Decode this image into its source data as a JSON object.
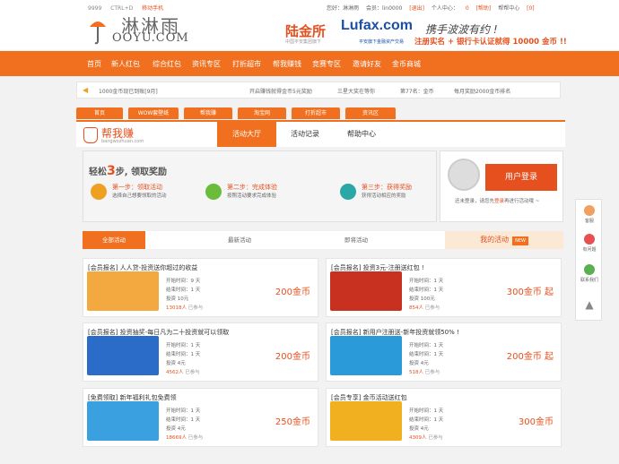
{
  "header": {
    "top_links": [
      "9999",
      "CTRL+D",
      "移动手机"
    ],
    "logo_cn": "淋淋雨",
    "logo_en": "OOYU.COM",
    "lufax_cn": "陆金所",
    "lufax_en": "Lufax.com",
    "lufax_sub1": "中国平安集团旗下",
    "lufax_sub2": "平安旗下金融资产交易",
    "user_bar": [
      "您好：淋淋雨",
      "会员：lin0000",
      "[退出]",
      "个人中心：",
      "0",
      "[帮助]",
      "帮帮中心",
      "[0]"
    ],
    "promo_line1": "携手波波有约 !",
    "promo_line2": "注册实名 + 银行卡认证就得 10000 金币 !!"
  },
  "nav": [
    "首页",
    "新人红包",
    "综合红包",
    "资讯专区",
    "打折超市",
    "帮我赚钱",
    "竞赛专区",
    "邀请好友",
    "金币商城"
  ],
  "notice": {
    "icon": "speaker-icon",
    "items": [
      "1000金币现已到账[9月]",
      "开启赚钱就得金币5元奖励",
      "三星大奖在等你",
      "第77名：金币",
      "每月奖励2000金币排名"
    ]
  },
  "subtabs": [
    "首页",
    "WOW套壁纸",
    "帮我赚",
    "淘宝网",
    "打折超市",
    "资讯区"
  ],
  "panel": {
    "logo_cn": "帮我赚",
    "logo_en": "bangwozhuan.com",
    "tabs": [
      "活动大厅",
      "活动记录",
      "帮助中心"
    ]
  },
  "steps": {
    "title_pre": "轻松",
    "title_num": "3",
    "title_post": "步, 领取奖励",
    "items": [
      {
        "l1": "第一步：领取活动",
        "l2": "选择自己想要领取的活动",
        "color": "#f0a020"
      },
      {
        "l1": "第二步：完成体验",
        "l2": "按照活动要求完成体验",
        "color": "#6cbc3c"
      },
      {
        "l1": "第三步：获得奖励",
        "l2": "获得活动相应的奖励",
        "color": "#2aa8a8"
      }
    ]
  },
  "login": {
    "button": "用户登录",
    "text_pre": "还未登录，请您先",
    "text_link": "登录",
    "text_post": "再进行活动哦 ~"
  },
  "side": [
    "客服",
    "有问题",
    "联系我们"
  ],
  "activity_tabs": {
    "all": "全部活动",
    "tab2": "最新活动",
    "tab3": "即将活动",
    "mine": "我的活动",
    "tag": "NEW"
  },
  "cards": [
    {
      "title": "[会员报名] 人人贷-投资送你超过的收益",
      "lines": [
        "开始时间：9 天",
        "结束时间：1 天",
        "投资 10元"
      ],
      "count": "13018人",
      "count_suffix": "已参与",
      "reward": "200金币",
      "img": "#f4a840"
    },
    {
      "title": "[会员报名] 投资3元-注册送红包 !",
      "lines": [
        "开始时间：1 天",
        "结束时间：1 天",
        "投资 100元"
      ],
      "count": "854人",
      "count_suffix": "已参与",
      "reward": "300金币 起",
      "img": "#c83020"
    },
    {
      "title": "[会员报名] 投资抽奖-每日凡为二十投资就可以领取",
      "lines": [
        "开始时间：1 天",
        "结束时间：1 天",
        "投资 4元"
      ],
      "count": "4562人",
      "count_suffix": "已参与",
      "reward": "200金币",
      "img": "#2a6cc8"
    },
    {
      "title": "[会员报名] 新用户注册送-新年投资就领50% !",
      "lines": [
        "开始时间：1 天",
        "结束时间：1 天",
        "投资 4元"
      ],
      "count": "518人",
      "count_suffix": "已参与",
      "reward": "200金币 起",
      "img": "#2a9ad8"
    },
    {
      "title": "[免费领取] 新年福利礼包免费领",
      "lines": [
        "开始时间：1 天",
        "结束时间：1 天",
        "投资 4元"
      ],
      "count": "18669人",
      "count_suffix": "已参与",
      "reward": "250金币",
      "img": "#3aa0e0"
    },
    {
      "title": "[会员专享] 金币活动送红包",
      "lines": [
        "开始时间：1 天",
        "结束时间：1 天",
        "投资 4元"
      ],
      "count": "4309人",
      "count_suffix": "已参与",
      "reward": "300金币",
      "img": "#f0b020"
    }
  ]
}
